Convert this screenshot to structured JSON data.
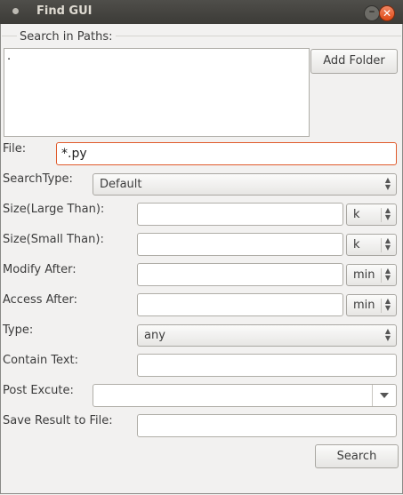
{
  "window": {
    "title": "Find GUI"
  },
  "paths": {
    "group_label": "Search in Paths:",
    "items": [
      "."
    ],
    "add_folder_label": "Add Folder"
  },
  "file": {
    "label": "File:",
    "value": "*.py"
  },
  "search_type": {
    "label": "SearchType:",
    "value": "Default"
  },
  "size_large": {
    "label": "Size(Large Than):",
    "value": "",
    "unit": "k"
  },
  "size_small": {
    "label": "Size(Small Than):",
    "value": "",
    "unit": "k"
  },
  "modify_after": {
    "label": "Modify After:",
    "value": "",
    "unit": "min"
  },
  "access_after": {
    "label": "Access After:",
    "value": "",
    "unit": "min"
  },
  "type": {
    "label": "Type:",
    "value": "any"
  },
  "contain_text": {
    "label": "Contain Text:",
    "value": ""
  },
  "post_excute": {
    "label": "Post Excute:",
    "value": ""
  },
  "save_result": {
    "label": "Save Result to File:",
    "value": ""
  },
  "search_button_label": "Search",
  "colors": {
    "focus_border": "#e05a2b",
    "close_button": "#df4a16",
    "titlebar": "#3c3b37"
  }
}
